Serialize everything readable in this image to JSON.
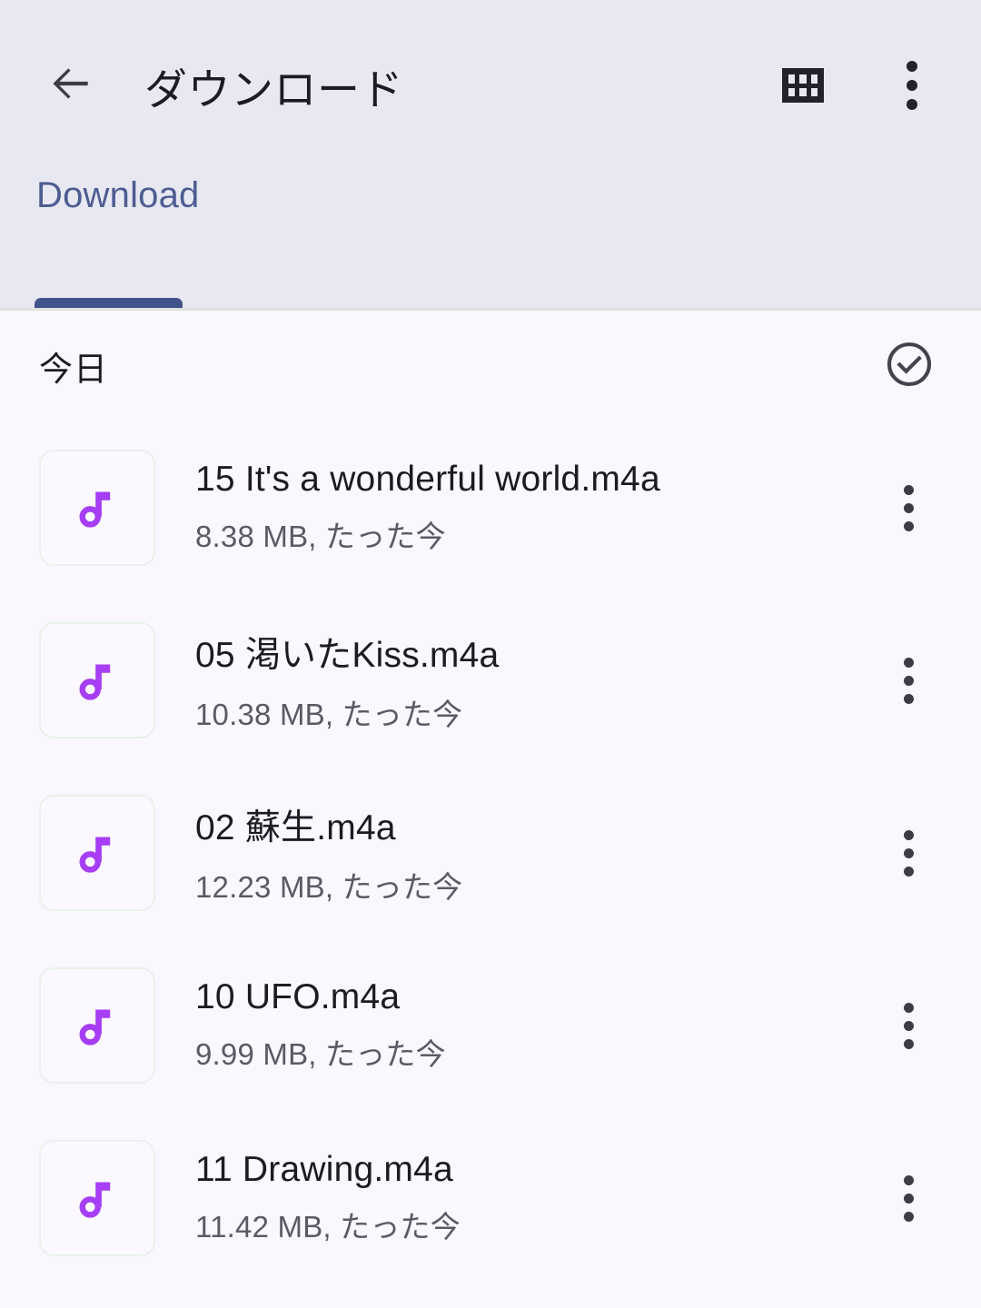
{
  "appbar": {
    "back_icon": "arrow-back-icon",
    "title": "ダウンロード",
    "grid_icon": "grid-view-icon",
    "overflow_icon": "more-vert-icon"
  },
  "tabs": [
    {
      "label": "Download",
      "selected": true
    }
  ],
  "section": {
    "title": "今日",
    "select_all_icon": "check-circle-icon"
  },
  "files": [
    {
      "name": "15 It's a wonderful world.m4a",
      "subtitle": "8.38 MB, たった今",
      "size": "8.38 MB",
      "time": "たった今",
      "icon": "music-note-icon",
      "menu_icon": "more-vert-icon"
    },
    {
      "name": "05 渇いたKiss.m4a",
      "subtitle": "10.38 MB, たった今",
      "size": "10.38 MB",
      "time": "たった今",
      "icon": "music-note-icon",
      "menu_icon": "more-vert-icon"
    },
    {
      "name": "02 蘇生.m4a",
      "subtitle": "12.23 MB, たった今",
      "size": "12.23 MB",
      "time": "たった今",
      "icon": "music-note-icon",
      "menu_icon": "more-vert-icon"
    },
    {
      "name": "10 UFO.m4a",
      "subtitle": "9.99 MB, たった今",
      "size": "9.99 MB",
      "time": "たった今",
      "icon": "music-note-icon",
      "menu_icon": "more-vert-icon"
    },
    {
      "name": "11 Drawing.m4a",
      "subtitle": "11.42 MB, たった今",
      "size": "11.42 MB",
      "time": "たった今",
      "icon": "music-note-icon",
      "menu_icon": "more-vert-icon"
    }
  ],
  "colors": {
    "appbar_bg": "#e8e8f2",
    "content_bg": "#faf7ff",
    "tab_text": "#4e5d91",
    "tab_indicator": "#41548c",
    "primary_text": "#1b1b22",
    "secondary_text": "#5b5a64",
    "music_accent": "#a63ef5",
    "divider": "#e0e1dd"
  }
}
